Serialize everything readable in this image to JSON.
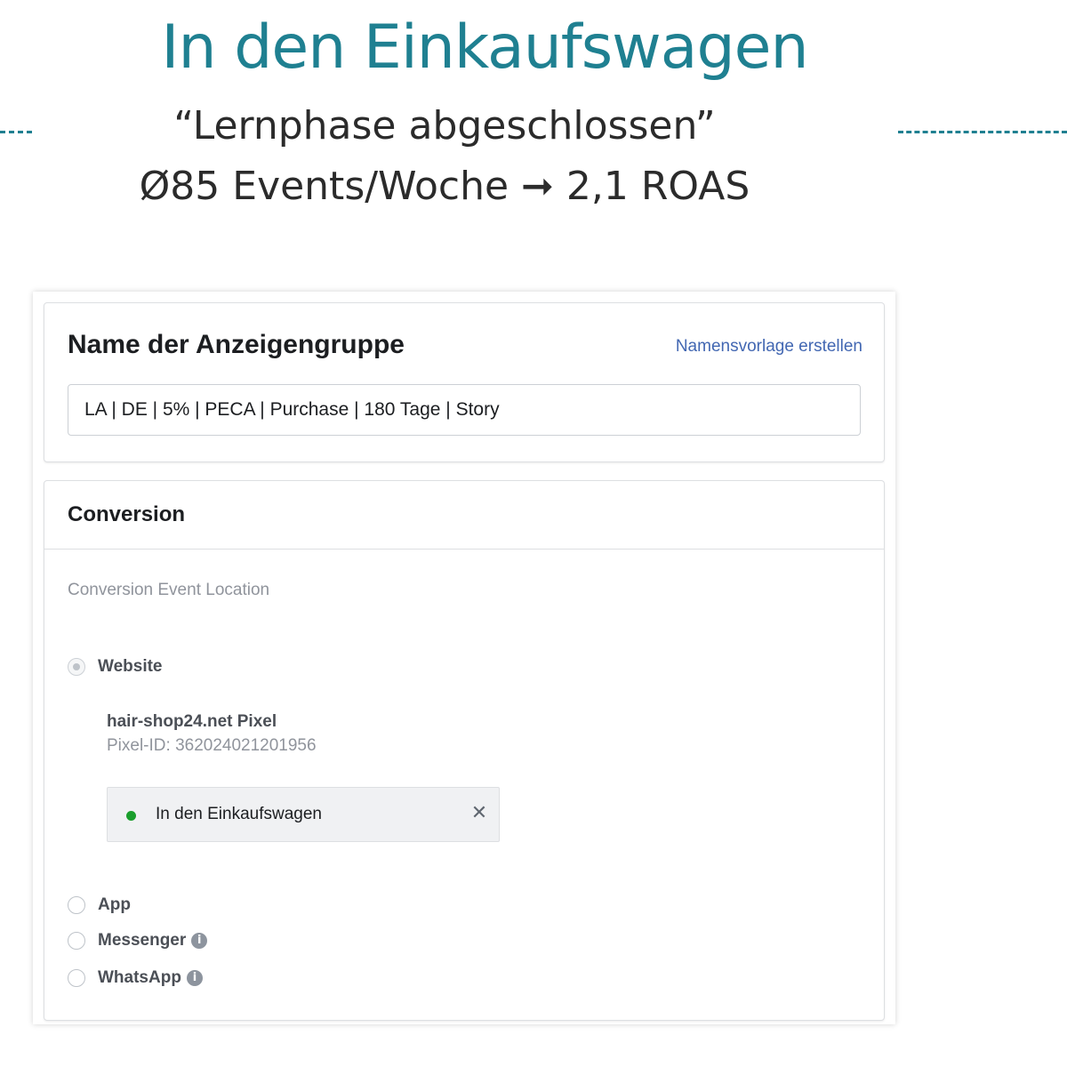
{
  "slide": {
    "title": "In den Einkaufswagen",
    "subtitle_line1": "“Lernphase abgeschlossen”",
    "subtitle_line2": "Ø85 Events/Woche ➞ 2,1 ROAS"
  },
  "ad_set": {
    "heading": "Name der Anzeigengruppe",
    "template_link": "Namensvorlage erstellen",
    "name_value": "LA | DE | 5% | PECA | Purchase | 180 Tage | Story"
  },
  "conversion": {
    "heading": "Conversion",
    "location_label": "Conversion Event Location",
    "options": [
      {
        "label": "Website",
        "selected": true
      },
      {
        "label": "App",
        "selected": false
      },
      {
        "label": "Messenger",
        "selected": false,
        "info_icon": "info-icon"
      },
      {
        "label": "WhatsApp",
        "selected": false,
        "info_icon": "info-icon"
      }
    ],
    "pixel": {
      "name": "hair-shop24.net Pixel",
      "id_text": "Pixel-ID: 362024021201956"
    },
    "event": {
      "name": "In den Einkaufswagen",
      "status_color": "#1a9e2c",
      "remove_icon": "close-icon"
    }
  },
  "colors": {
    "accent_teal": "#1f8091",
    "link_blue": "#4267b2"
  }
}
